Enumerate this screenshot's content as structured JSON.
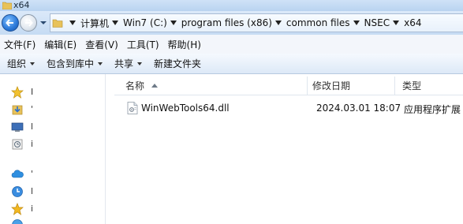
{
  "window": {
    "title": "x64"
  },
  "address": {
    "crumbs": [
      "计算机",
      "Win7 (C:)",
      "program files (x86)",
      "common files",
      "NSEC",
      "x64"
    ]
  },
  "menu": {
    "items": [
      "文件(F)",
      "编辑(E)",
      "查看(V)",
      "工具(T)",
      "帮助(H)"
    ]
  },
  "toolbar": {
    "organize": "组织",
    "include_in_library": "包含到库中",
    "share": "共享",
    "new_folder": "新建文件夹"
  },
  "navpane": {
    "items": [
      {
        "icon": "favorites-star-icon",
        "label": "I"
      },
      {
        "icon": "downloads-icon",
        "label": "'"
      },
      {
        "icon": "desktop-icon",
        "label": "l"
      },
      {
        "icon": "recent-places-icon",
        "label": "i"
      },
      {
        "icon": "cloud-icon",
        "label": "'"
      },
      {
        "icon": "clock-icon",
        "label": "l"
      },
      {
        "icon": "star-icon",
        "label": "i"
      },
      {
        "icon": "globe-icon",
        "label": ""
      }
    ]
  },
  "filelist": {
    "columns": {
      "name": "名称",
      "date_modified": "修改日期",
      "type": "类型"
    },
    "rows": [
      {
        "icon": "dll-file-icon",
        "name": "WinWebTools64.dll",
        "date_modified": "2024.03.01 18:07",
        "type": "应用程序扩展"
      }
    ]
  },
  "colors": {
    "titlebar": "#c5dbf3",
    "back_button": "#2a78d8",
    "folder": "#e8c25a",
    "background": "#ffffff"
  }
}
